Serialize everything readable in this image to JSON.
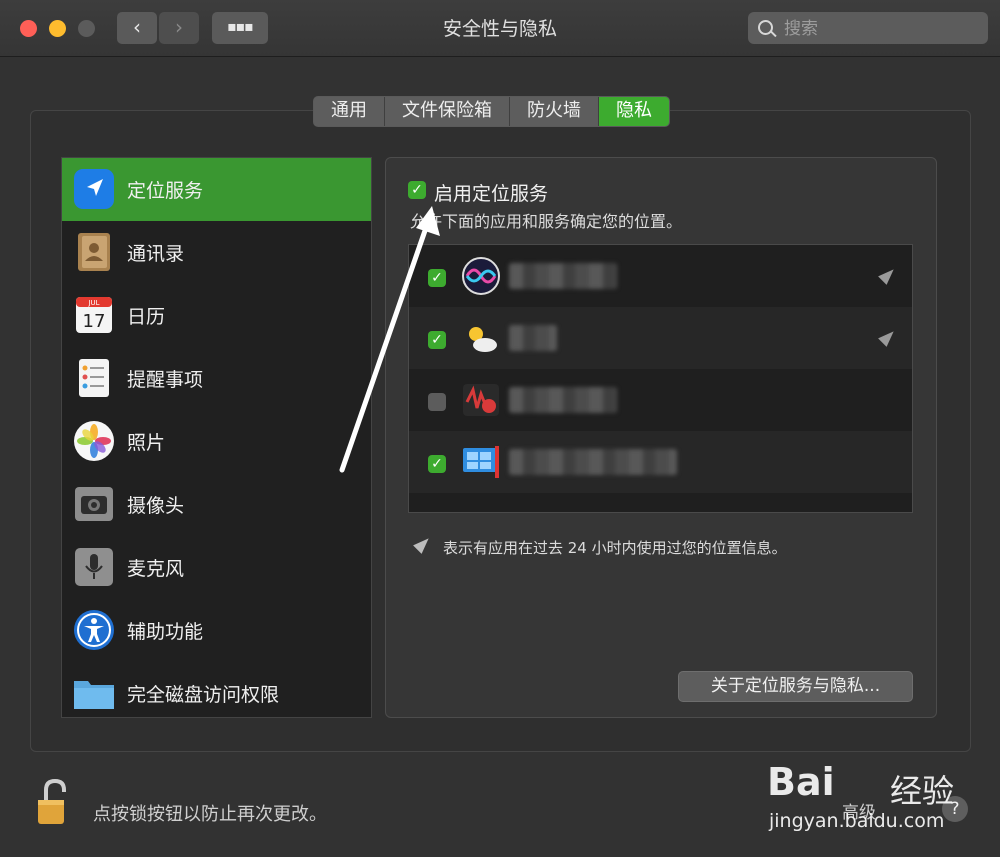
{
  "window": {
    "title": "安全性与隐私",
    "search_placeholder": "搜索"
  },
  "toolbar": {
    "back_icon": "‹",
    "forward_icon": "›",
    "grid_icon": "▪▪▪"
  },
  "tabs": [
    {
      "label": "通用",
      "active": false
    },
    {
      "label": "文件保险箱",
      "active": false
    },
    {
      "label": "防火墙",
      "active": false
    },
    {
      "label": "隐私",
      "active": true
    }
  ],
  "sidebar": {
    "items": [
      {
        "label": "定位服务",
        "icon": "location-arrow-icon",
        "selected": true
      },
      {
        "label": "通讯录",
        "icon": "contacts-icon",
        "selected": false
      },
      {
        "label": "日历",
        "icon": "calendar-icon",
        "selected": false
      },
      {
        "label": "提醒事项",
        "icon": "reminders-icon",
        "selected": false
      },
      {
        "label": "照片",
        "icon": "photos-icon",
        "selected": false
      },
      {
        "label": "摄像头",
        "icon": "camera-icon",
        "selected": false
      },
      {
        "label": "麦克风",
        "icon": "microphone-icon",
        "selected": false
      },
      {
        "label": "辅助功能",
        "icon": "accessibility-icon",
        "selected": false
      },
      {
        "label": "完全磁盘访问权限",
        "icon": "folder-icon",
        "selected": false
      }
    ]
  },
  "panel": {
    "enable_checkbox_checked": true,
    "enable_label": "启用定位服务",
    "description": "允许下面的应用和服务确定您的位置。",
    "apps": [
      {
        "checked": true,
        "icon": "siri-icon",
        "recent_location_use": true
      },
      {
        "checked": true,
        "icon": "weather-icon",
        "recent_location_use": true
      },
      {
        "checked": false,
        "icon": "app-icon",
        "recent_location_use": false
      },
      {
        "checked": true,
        "icon": "windows-app-icon",
        "recent_location_use": false
      }
    ],
    "note": "表示有应用在过去 24 小时内使用过您的位置信息。",
    "about_button": "关于定位服务与隐私..."
  },
  "footer": {
    "lock_label": "点按锁按钮以防止再次更改。",
    "advanced_label": "高级",
    "help_label": "?"
  },
  "watermark": {
    "logo": "Bai",
    "brand": "经验",
    "url": "jingyan.baidu.com"
  },
  "colors": {
    "accent_green": "#3dab2f",
    "selected_row": "#3a9731",
    "background": "#323232"
  }
}
